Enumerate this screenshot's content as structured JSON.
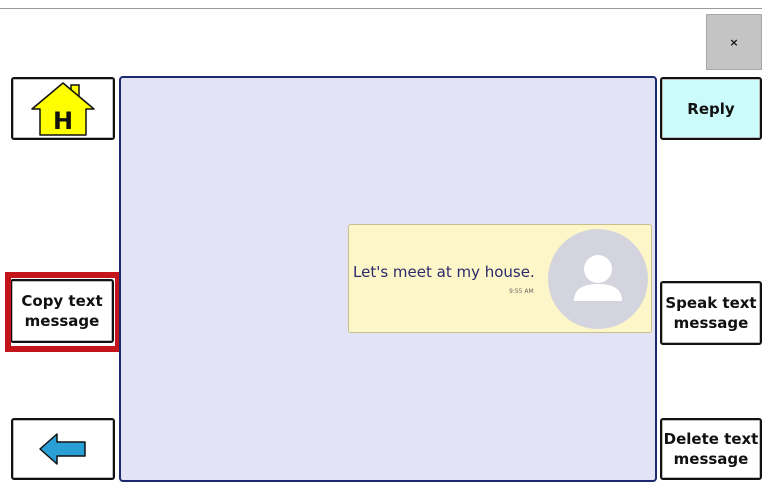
{
  "window": {
    "close_label": "×"
  },
  "left_column": {
    "home_button": {
      "icon": "house-icon",
      "letter": "H"
    },
    "copy_button_label": "Copy text message",
    "back_button": {
      "icon": "back-arrow-icon"
    }
  },
  "right_column": {
    "reply_label": "Reply",
    "speak_label": "Speak text message",
    "delete_label": "Delete text message"
  },
  "message": {
    "text": "Let's meet at my house.",
    "time": "9:55 AM",
    "avatar_icon": "person-placeholder-icon"
  },
  "colors": {
    "highlight": "#c4141c",
    "message_area": "#e3e3f6",
    "bubble": "#fdf6c9",
    "reply_bg": "#ccfbfb",
    "house_fill": "#ffff00",
    "arrow_fill": "#2a9fd6"
  }
}
